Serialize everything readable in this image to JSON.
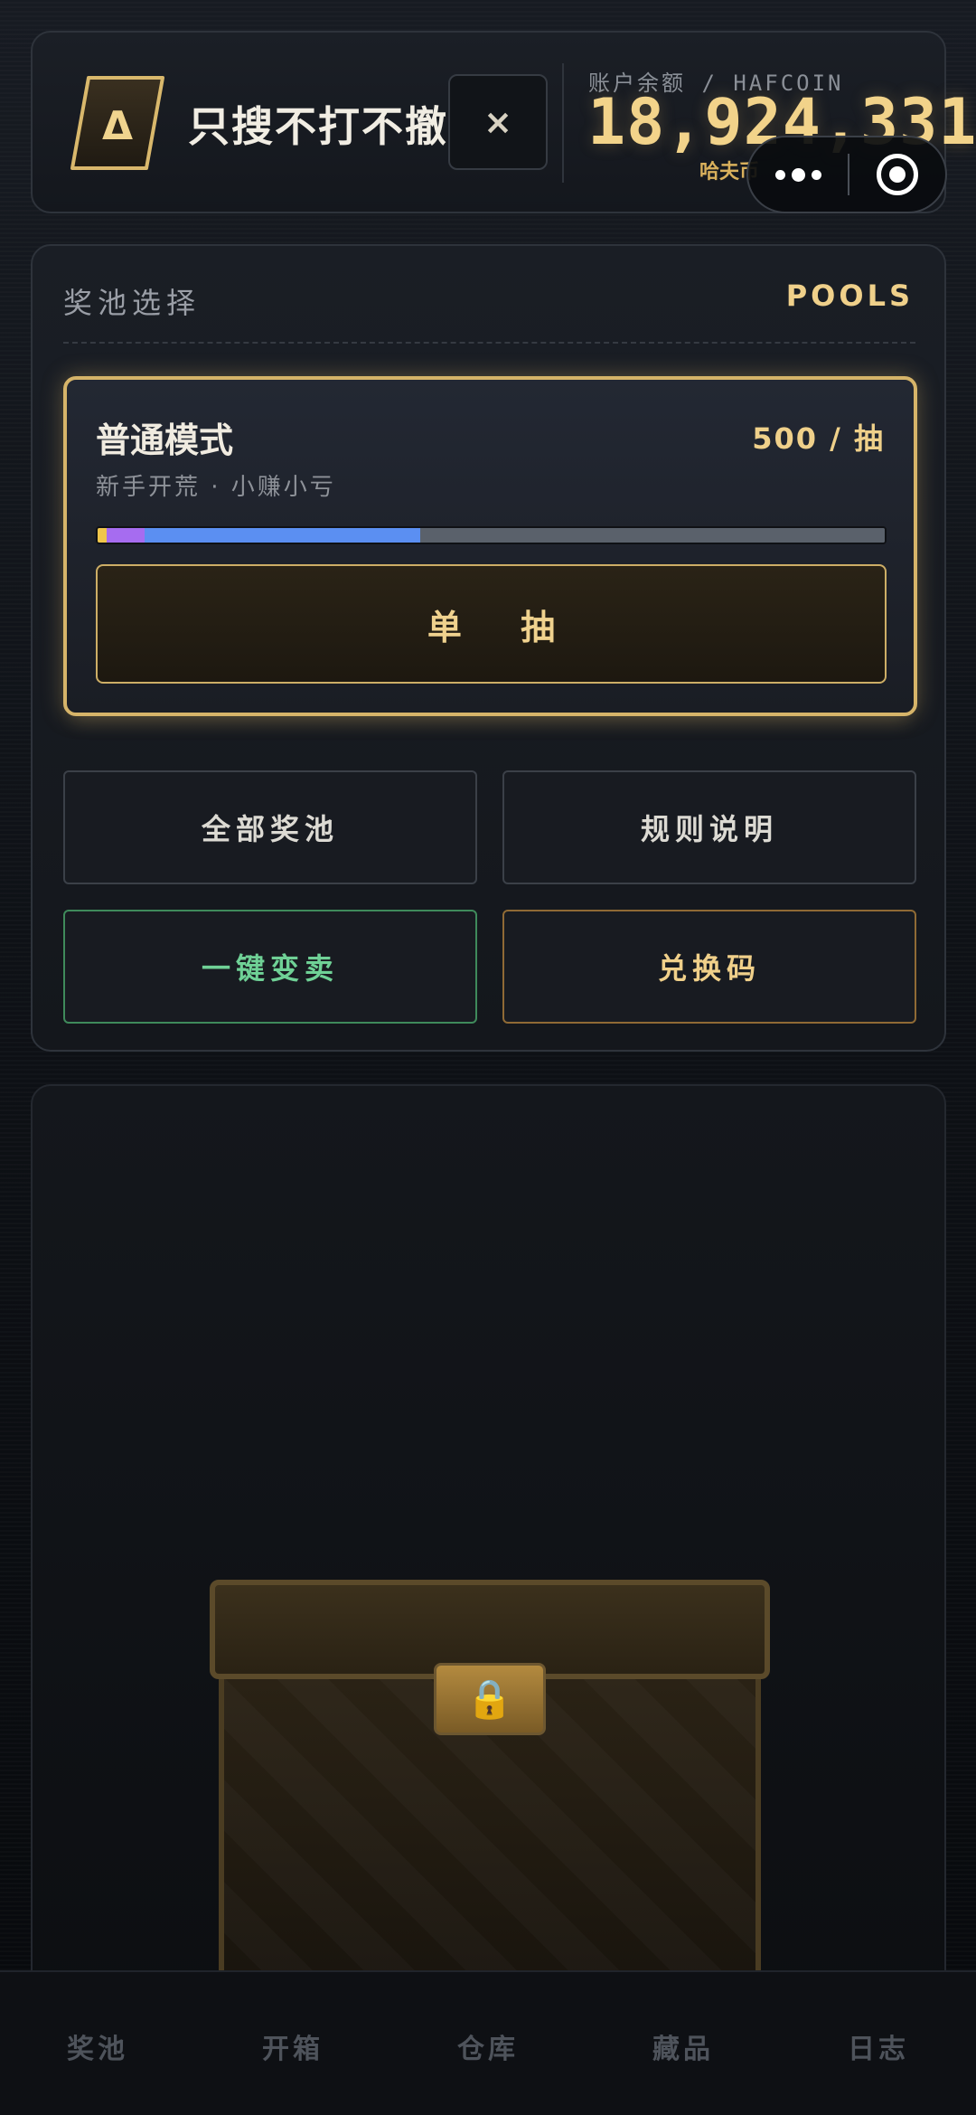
{
  "header": {
    "logo_letter": "Δ",
    "app_title": "只搜不打不撤",
    "close_label": "×",
    "balance_label": "账户余额 / HAFCOIN",
    "balance_value": "18,924,331",
    "balance_unit": "哈夫币"
  },
  "capsule": {
    "more_icon": "more-dots-icon",
    "target_icon": "target-circle-icon"
  },
  "pools": {
    "section_label": "奖池选择",
    "section_tag": "POOLS",
    "selected_mode": {
      "title": "普通模式",
      "price": "500 / 抽",
      "subtitle": "新手开荒 · 小赚小亏",
      "odds_segments": [
        {
          "fraction": 0.012,
          "color": "#f0c64a"
        },
        {
          "fraction": 0.048,
          "color": "#a66cf0"
        },
        {
          "fraction": 0.35,
          "color": "#5b8ff2"
        },
        {
          "fraction": 0.59,
          "color": "#5a616b"
        }
      ],
      "draw_label": "单 抽"
    },
    "buttons": {
      "all_pools": "全部奖池",
      "rules": "规则说明",
      "quick_sell": "一键变卖",
      "redeem_code": "兑换码"
    }
  },
  "chest": {
    "lock_icon": "🔒"
  },
  "tabs": [
    {
      "label": "奖池"
    },
    {
      "label": "开箱"
    },
    {
      "label": "仓库"
    },
    {
      "label": "藏品"
    },
    {
      "label": "日志"
    }
  ],
  "colors": {
    "accent_gold": "#efd08a",
    "sell_green": "#6fd196",
    "code_orange": "#8f6a35"
  }
}
